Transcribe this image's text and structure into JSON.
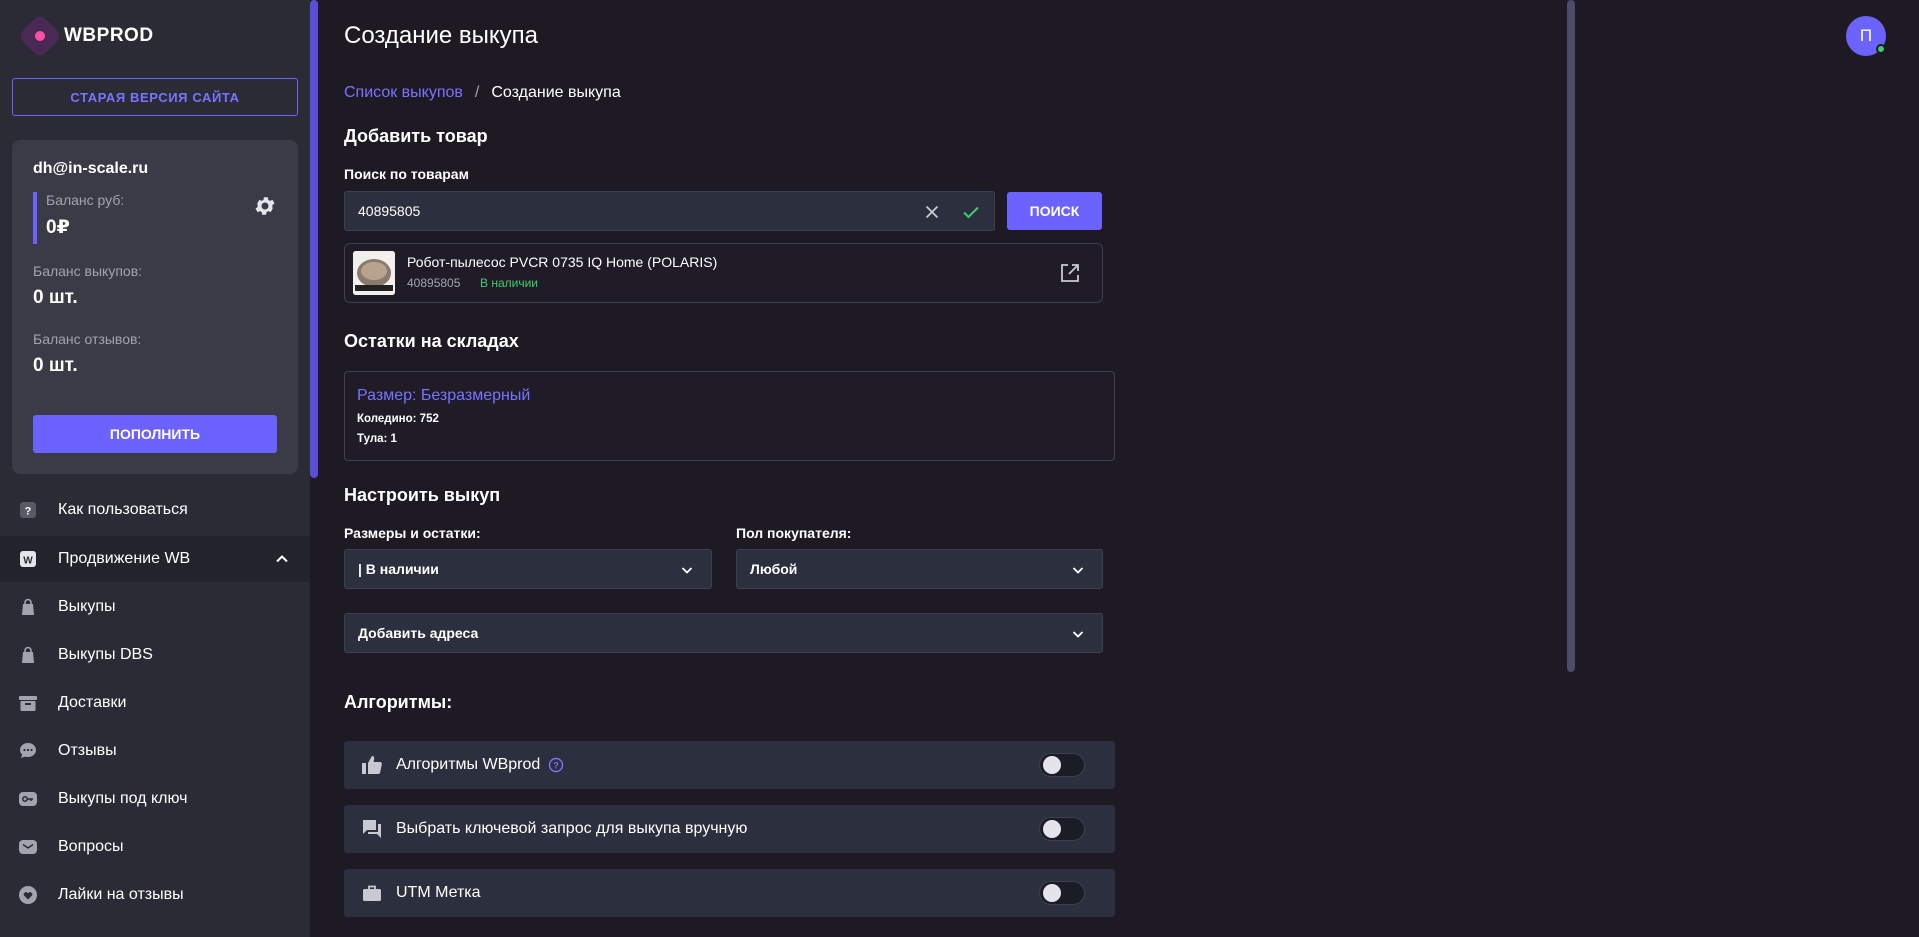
{
  "brand": {
    "name": "WBPROD"
  },
  "sidebar": {
    "old_version_label": "СТАРАЯ ВЕРСИЯ САЙТА",
    "account": {
      "email": "dh@in-scale.ru",
      "balance_rub_label": "Баланс руб:",
      "balance_rub_value": "0₽",
      "balance_buyouts_label": "Баланс выкупов:",
      "balance_buyouts_value": "0 шт.",
      "balance_reviews_label": "Баланс отзывов:",
      "balance_reviews_value": "0 шт.",
      "topup_label": "ПОПОЛНИТЬ"
    },
    "items": [
      {
        "label": "Как пользоваться",
        "icon": "question-icon"
      },
      {
        "label": "Продвижение WB",
        "icon": "wb-icon"
      },
      {
        "label": "Выкупы",
        "icon": "bag-icon"
      },
      {
        "label": "Выкупы DBS",
        "icon": "bag-icon"
      },
      {
        "label": "Доставки",
        "icon": "archive-icon"
      },
      {
        "label": "Отзывы",
        "icon": "chat-icon"
      },
      {
        "label": "Выкупы под ключ",
        "icon": "key-icon"
      },
      {
        "label": "Вопросы",
        "icon": "mail-icon"
      },
      {
        "label": "Лайки на отзывы",
        "icon": "heart-icon"
      }
    ]
  },
  "header": {
    "title": "Создание выкупа",
    "avatar_initial": "П"
  },
  "breadcrumb": {
    "link": "Список выкупов",
    "separator": "/",
    "current": "Создание выкупа"
  },
  "add_product": {
    "title": "Добавить товар",
    "search_label": "Поиск по товарам",
    "search_value": "40895805",
    "search_button": "ПОИСК",
    "product": {
      "name": "Робот-пылесос PVCR 0735 IQ Home (POLARIS)",
      "sku": "40895805",
      "stock_status": "В наличии"
    }
  },
  "warehouses": {
    "title": "Остатки на складах",
    "size_label": "Размер: Безразмерный",
    "lines": [
      "Коледино: 752",
      "Тула: 1"
    ]
  },
  "configure": {
    "title": "Настроить выкуп",
    "sizes_label": "Размеры и остатки:",
    "sizes_value": "| В наличии",
    "gender_label": "Пол покупателя:",
    "gender_value": "Любой",
    "addresses_value": "Добавить адреса"
  },
  "algorithms": {
    "title": "Алгоритмы:",
    "rows": [
      {
        "label": "Алгоритмы WBprod",
        "icon": "thumbs-up-icon",
        "enabled": false
      },
      {
        "label": "Выбрать ключевой запрос для выкупа вручную",
        "icon": "chat-bubbles-icon",
        "enabled": false
      },
      {
        "label": "UTM Метка",
        "icon": "briefcase-icon",
        "enabled": false
      }
    ]
  },
  "colors": {
    "accent": "#6c63ff",
    "success": "#3ccf6e",
    "background": "#1e1a24",
    "sidebar": "#2b2b36"
  }
}
